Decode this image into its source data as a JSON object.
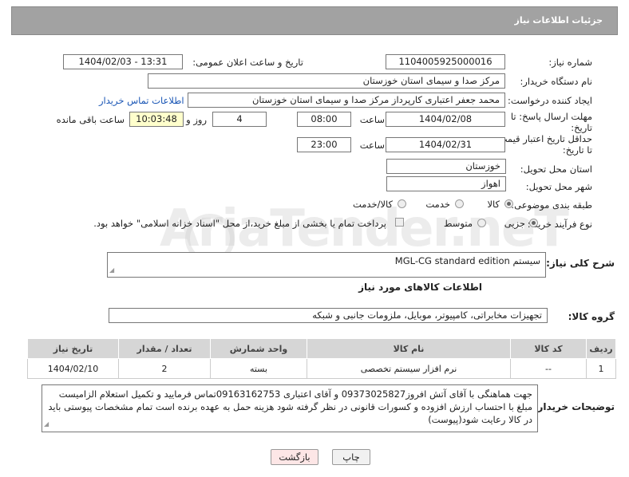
{
  "header": {
    "title": "جزئیات اطلاعات نیاز"
  },
  "fields": {
    "need_number_label": "شماره نیاز:",
    "need_number": "1104005925000016",
    "announce_label": "تاریخ و ساعت اعلان عمومی:",
    "announce_value": "1404/02/03 - 13:31",
    "buyer_org_label": "نام دستگاه خریدار:",
    "buyer_org": "مرکز صدا و سیمای استان خوزستان",
    "creator_label": "ایجاد کننده درخواست:",
    "creator": "محمد جعفر اعتباری کارپرداز مرکز صدا و سیمای استان خوزستان",
    "contact_link": "اطلاعات تماس خریدار",
    "deadline_label_1": "مهلت ارسال پاسخ: تا",
    "deadline_label_2": "تاریخ:",
    "deadline_date": "1404/02/08",
    "time_label": "ساعت",
    "deadline_time": "08:00",
    "days": "4",
    "days_label": "روز و",
    "remaining": "10:03:48",
    "remaining_label": "ساعت باقی مانده",
    "price_label_1": "حداقل تاریخ اعتبار قیمت:",
    "price_label_2": "تا تاریخ:",
    "price_date": "1404/02/31",
    "price_time": "23:00",
    "province_label": "استان محل تحویل:",
    "province": "خوزستان",
    "city_label": "شهر محل تحویل:",
    "city": "اهواز",
    "category_label": "طبقه بندی موضوعی:",
    "category_options": [
      "کالا",
      "خدمت",
      "کالا/خدمت"
    ],
    "process_label": "نوع فرآیند خرید :",
    "process_options": [
      "جزیی",
      "متوسط"
    ],
    "payment_note": "پرداخت تمام یا بخشی از مبلغ خرید،از محل \"اسناد خزانه اسلامی\" خواهد بود."
  },
  "description": {
    "label": "شرح کلی نیاز:",
    "value": "سیستم MGL-CG standard edition"
  },
  "goods": {
    "section_title": "اطلاعات کالاهای مورد نیاز",
    "group_label": "گروه کالا:",
    "group_value": "تجهیزات مخابراتی، کامپیوتر، موبایل، ملزومات جانبی و شبکه"
  },
  "table": {
    "headers": [
      "ردیف",
      "کد کالا",
      "نام کالا",
      "واحد شمارش",
      "تعداد / مقدار",
      "تاریخ نیاز"
    ],
    "rows": [
      [
        "1",
        "--",
        "نرم افزار سیستم تخصصی",
        "بسته",
        "2",
        "1404/02/10"
      ]
    ]
  },
  "buyer_notes": {
    "label": "توضیحات خریدار:",
    "value": "جهت هماهنگی با آقای آتش افروز09373025827 و آقای اعتباری 09163162753تماس فرمایید و تکمیل استعلام الزامیست مبلغ با احتساب ارزش افزوده و کسورات قانونی در نظر گرفته شود هزینه حمل به عهده برنده است تمام مشخصات پیوستی باید در کالا رعایت شود(پیوست)"
  },
  "buttons": {
    "print": "چاپ",
    "back": "بازگشت"
  },
  "watermark": "AriaTender.neT",
  "colors": {
    "header_bg": "#a2a2a2",
    "link": "#1a56b5",
    "yellow_box": "#ffffcc",
    "back_button_bg": "#fde6e6"
  }
}
